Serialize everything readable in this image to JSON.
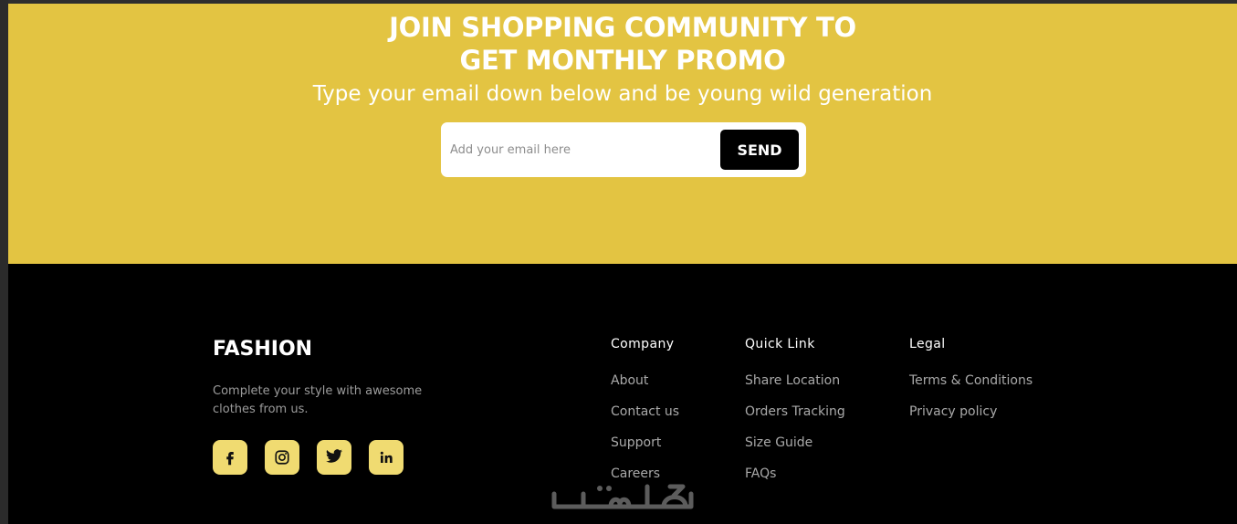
{
  "promo": {
    "title_line1": "JOIN SHOPPING COMMUNITY TO",
    "title_line2": "GET MONTHLY PROMO",
    "subtitle": "Type your email down below and be young wild generation",
    "email_placeholder": "Add your email here",
    "send_label": "SEND",
    "bg_color": "#e3c442"
  },
  "footer": {
    "brand": "FASHION",
    "description": "Complete your style with awesome clothes from us.",
    "socials": [
      {
        "icon": "facebook-icon"
      },
      {
        "icon": "instagram-icon"
      },
      {
        "icon": "twitter-icon"
      },
      {
        "icon": "linkedin-icon"
      }
    ],
    "columns": [
      {
        "title": "Company",
        "links": [
          "About",
          "Contact us",
          "Support",
          "Careers"
        ]
      },
      {
        "title": "Quick Link",
        "links": [
          "Share Location",
          "Orders Tracking",
          "Size Guide",
          "FAQs"
        ]
      },
      {
        "title": "Legal",
        "links": [
          "Terms & Conditions",
          "Privacy policy"
        ]
      }
    ],
    "social_color": "#f0db71"
  },
  "watermark": {
    "text": "خمسات"
  }
}
